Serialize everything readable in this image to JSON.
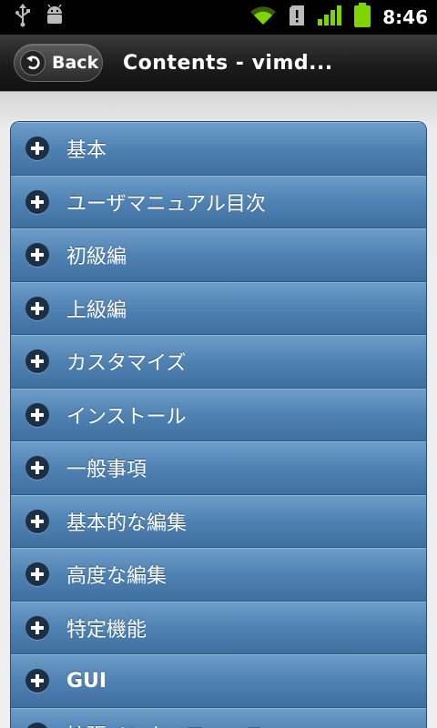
{
  "status_bar": {
    "time": "8:46",
    "icons": [
      "usb-icon",
      "android-debug-icon",
      "wifi-icon",
      "sd-card-alert-icon",
      "signal-icon",
      "battery-icon"
    ],
    "accent": "#7fd400"
  },
  "header": {
    "back_label": "Back",
    "title": "Contents - vimd..."
  },
  "colors": {
    "list_item_bg": "#4f82b3",
    "header_bg": "#1c1c1c",
    "page_bg": "#efefef"
  },
  "contents": {
    "items": [
      {
        "label": "基本"
      },
      {
        "label": "ユーザマニュアル目次"
      },
      {
        "label": "初級編"
      },
      {
        "label": "上級編"
      },
      {
        "label": "カスタマイズ"
      },
      {
        "label": "インストール"
      },
      {
        "label": "一般事項"
      },
      {
        "label": "基本的な編集"
      },
      {
        "label": "高度な編集"
      },
      {
        "label": "特定機能"
      },
      {
        "label": "GUI"
      },
      {
        "label": "拡張インターフェース"
      }
    ]
  }
}
